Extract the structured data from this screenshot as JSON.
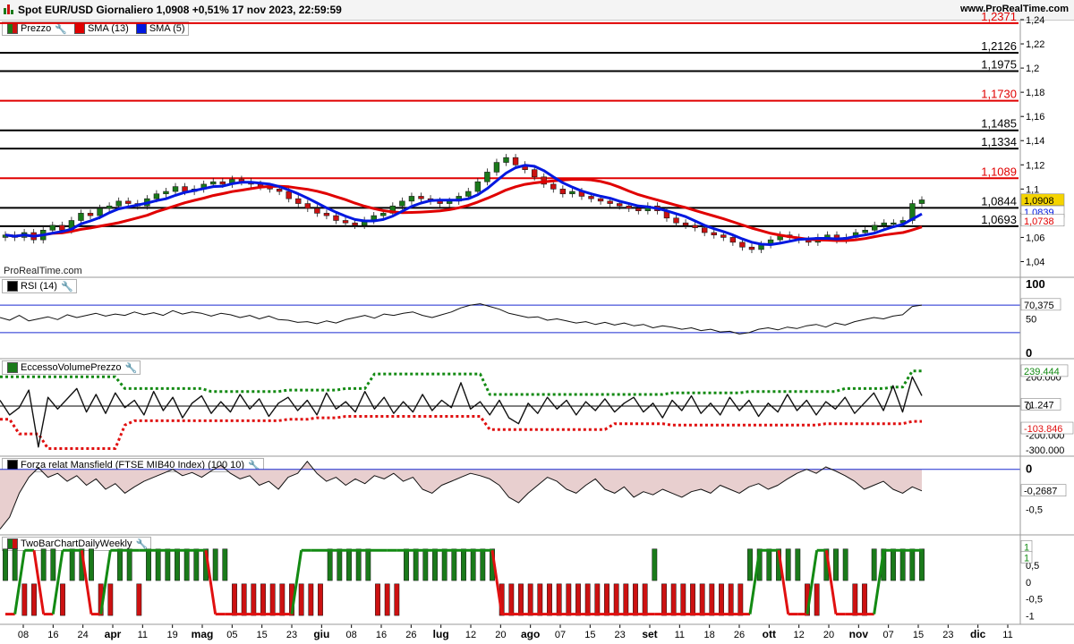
{
  "header": {
    "title": "Spot EUR/USD Giornaliero 1,0908 +0,51% 17 nov 2023, 22:59:59",
    "brand": "www.ProRealTime.com",
    "watermark": "ProRealTime.com"
  },
  "legends": {
    "price": {
      "label": "Prezzo",
      "sma13": "SMA (13)",
      "sma5": "SMA (5)"
    },
    "rsi": "RSI (14)",
    "volume": "EccessoVolumePrezzo",
    "mansfield": "Forza relat Mansfield (FTSE MIB40 Index) (100 10)",
    "twobar": "TwoBarChartDailyWeekly"
  },
  "colors": {
    "up": "#1a7a1a",
    "down": "#cc1111",
    "sma13": "#e00000",
    "sma5": "#0018e0",
    "hline_red": "#e00000",
    "hline_black": "#000000",
    "current": "#f5d400"
  },
  "price_axis": {
    "ticks": [
      "1,24",
      "1,22",
      "1,2",
      "1,18",
      "1,16",
      "1,14",
      "1,12",
      "1,1",
      "1,08",
      "1,06",
      "1,04"
    ]
  },
  "x_axis": {
    "labels": [
      "08",
      "16",
      "24",
      "apr",
      "11",
      "19",
      "mag",
      "05",
      "15",
      "23",
      "giu",
      "08",
      "16",
      "26",
      "lug",
      "12",
      "20",
      "ago",
      "07",
      "15",
      "23",
      "set",
      "11",
      "18",
      "26",
      "ott",
      "12",
      "20",
      "nov",
      "07",
      "15",
      "23",
      "dic",
      "11"
    ]
  },
  "chart_data": [
    {
      "type": "candlestick",
      "title": "Spot EUR/USD Giornaliero",
      "ylim": [
        1.03,
        1.24
      ],
      "horizontal_levels": [
        {
          "value": 1.2371,
          "label": "1,2371",
          "color": "red"
        },
        {
          "value": 1.2126,
          "label": "1,2126",
          "color": "black"
        },
        {
          "value": 1.1975,
          "label": "1,1975",
          "color": "black"
        },
        {
          "value": 1.173,
          "label": "1,1730",
          "color": "red"
        },
        {
          "value": 1.1485,
          "label": "1,1485",
          "color": "black"
        },
        {
          "value": 1.1334,
          "label": "1,1334",
          "color": "black"
        },
        {
          "value": 1.1089,
          "label": "1,1089",
          "color": "red"
        },
        {
          "value": 1.0844,
          "label": "1,0844",
          "color": "black"
        },
        {
          "value": 1.0693,
          "label": "1,0693",
          "color": "black"
        }
      ],
      "last_price": {
        "value": 1.0908,
        "label": "1,0908"
      },
      "sma5_last": {
        "value": 1.0839,
        "label": "1,0839"
      },
      "sma13_last": {
        "value": 1.0738,
        "label": "1,0738"
      },
      "close_path": [
        1.062,
        1.06,
        1.064,
        1.058,
        1.066,
        1.07,
        1.066,
        1.074,
        1.08,
        1.078,
        1.084,
        1.086,
        1.09,
        1.088,
        1.086,
        1.092,
        1.096,
        1.098,
        1.102,
        1.098,
        1.1,
        1.104,
        1.106,
        1.104,
        1.108,
        1.106,
        1.104,
        1.102,
        1.1,
        1.098,
        1.092,
        1.088,
        1.084,
        1.08,
        1.078,
        1.074,
        1.072,
        1.07,
        1.074,
        1.078,
        1.08,
        1.086,
        1.09,
        1.094,
        1.092,
        1.09,
        1.088,
        1.09,
        1.094,
        1.098,
        1.106,
        1.114,
        1.122,
        1.126,
        1.12,
        1.116,
        1.11,
        1.104,
        1.1,
        1.096,
        1.098,
        1.094,
        1.092,
        1.09,
        1.088,
        1.086,
        1.084,
        1.082,
        1.086,
        1.082,
        1.076,
        1.072,
        1.07,
        1.068,
        1.064,
        1.062,
        1.06,
        1.056,
        1.052,
        1.05,
        1.054,
        1.058,
        1.062,
        1.06,
        1.058,
        1.056,
        1.06,
        1.062,
        1.058,
        1.06,
        1.064,
        1.066,
        1.07,
        1.072,
        1.072,
        1.074,
        1.088,
        1.091
      ]
    },
    {
      "type": "line",
      "title": "RSI (14)",
      "ylim": [
        0,
        100
      ],
      "ticks": [
        "100",
        "50",
        "0"
      ],
      "reference_lines": [
        30,
        70
      ],
      "last": {
        "value": 70.375,
        "label": "70,375"
      },
      "values": [
        52,
        48,
        55,
        47,
        50,
        53,
        49,
        56,
        52,
        55,
        58,
        54,
        57,
        55,
        60,
        56,
        59,
        55,
        62,
        57,
        60,
        58,
        54,
        58,
        56,
        52,
        55,
        50,
        54,
        49,
        48,
        45,
        46,
        43,
        47,
        44,
        49,
        52,
        55,
        51,
        57,
        55,
        58,
        60,
        55,
        52,
        56,
        60,
        66,
        70,
        72,
        68,
        64,
        58,
        55,
        52,
        53,
        48,
        50,
        47,
        44,
        46,
        42,
        45,
        41,
        44,
        40,
        42,
        37,
        40,
        38,
        35,
        37,
        33,
        35,
        31,
        32,
        28,
        30,
        35,
        37,
        34,
        38,
        36,
        40,
        42,
        38,
        44,
        41,
        46,
        49,
        52,
        50,
        54,
        56,
        68,
        70
      ]
    },
    {
      "type": "line",
      "title": "EccessoVolumePrezzo",
      "ylim": [
        -330000,
        300000
      ],
      "ticks": [
        "200.000",
        "0",
        "-200.000",
        "-300.000"
      ],
      "markers": [
        {
          "value": 239444,
          "label": "239.444"
        },
        {
          "value": 71247,
          "label": "71.247"
        },
        {
          "value": 0,
          "label": "0"
        },
        {
          "value": -103846,
          "label": "-103.846"
        }
      ],
      "upper_band": [
        200000,
        200000,
        200000,
        200000,
        200000,
        200000,
        200000,
        200000,
        200000,
        200000,
        200000,
        200000,
        200000,
        120000,
        120000,
        120000,
        120000,
        120000,
        120000,
        120000,
        120000,
        120000,
        100000,
        100000,
        100000,
        100000,
        100000,
        100000,
        100000,
        100000,
        110000,
        110000,
        110000,
        110000,
        110000,
        110000,
        120000,
        120000,
        120000,
        220000,
        220000,
        220000,
        220000,
        220000,
        220000,
        220000,
        220000,
        220000,
        220000,
        220000,
        220000,
        80000,
        80000,
        80000,
        80000,
        80000,
        80000,
        80000,
        80000,
        80000,
        80000,
        80000,
        80000,
        80000,
        80000,
        80000,
        80000,
        80000,
        80000,
        80000,
        90000,
        90000,
        90000,
        90000,
        90000,
        90000,
        90000,
        90000,
        100000,
        100000,
        100000,
        100000,
        100000,
        100000,
        100000,
        100000,
        100000,
        100000,
        120000,
        120000,
        120000,
        120000,
        120000,
        130000,
        130000,
        240000,
        240000
      ],
      "lower_band": [
        -90000,
        -90000,
        -190000,
        -190000,
        -190000,
        -290000,
        -290000,
        -290000,
        -290000,
        -290000,
        -290000,
        -290000,
        -290000,
        -130000,
        -100000,
        -100000,
        -100000,
        -100000,
        -100000,
        -100000,
        -100000,
        -100000,
        -100000,
        -100000,
        -100000,
        -100000,
        -100000,
        -100000,
        -100000,
        -100000,
        -90000,
        -90000,
        -90000,
        -80000,
        -80000,
        -80000,
        -70000,
        -70000,
        -70000,
        -70000,
        -70000,
        -70000,
        -70000,
        -70000,
        -70000,
        -70000,
        -70000,
        -70000,
        -70000,
        -70000,
        -70000,
        -160000,
        -160000,
        -160000,
        -160000,
        -160000,
        -160000,
        -160000,
        -160000,
        -160000,
        -160000,
        -160000,
        -160000,
        -160000,
        -120000,
        -120000,
        -120000,
        -120000,
        -120000,
        -120000,
        -130000,
        -130000,
        -130000,
        -130000,
        -130000,
        -130000,
        -130000,
        -130000,
        -130000,
        -130000,
        -130000,
        -130000,
        -130000,
        -130000,
        -130000,
        -130000,
        -120000,
        -120000,
        -120000,
        -120000,
        -120000,
        -120000,
        -120000,
        -120000,
        -120000,
        -104000,
        -104000
      ],
      "values": [
        40000,
        -60000,
        -10000,
        110000,
        -280000,
        60000,
        -20000,
        50000,
        120000,
        -40000,
        80000,
        -50000,
        90000,
        -10000,
        40000,
        -60000,
        100000,
        -30000,
        60000,
        -80000,
        20000,
        70000,
        -50000,
        30000,
        -40000,
        80000,
        -20000,
        50000,
        -70000,
        20000,
        60000,
        -30000,
        40000,
        -60000,
        90000,
        -20000,
        30000,
        -40000,
        100000,
        -20000,
        60000,
        -50000,
        30000,
        -40000,
        80000,
        -30000,
        40000,
        -10000,
        160000,
        -20000,
        30000,
        -60000,
        40000,
        -80000,
        -120000,
        20000,
        -50000,
        60000,
        -20000,
        40000,
        -60000,
        30000,
        -30000,
        50000,
        -40000,
        20000,
        60000,
        -40000,
        20000,
        -80000,
        40000,
        -30000,
        70000,
        -50000,
        20000,
        -60000,
        60000,
        -30000,
        40000,
        -70000,
        20000,
        -40000,
        80000,
        -30000,
        40000,
        -60000,
        30000,
        -20000,
        60000,
        -50000,
        20000,
        90000,
        -30000,
        140000,
        -40000,
        200000,
        71000
      ]
    },
    {
      "type": "area",
      "title": "Forza relat Mansfield (FTSE MIB40 Index) (100 10)",
      "ylim": [
        -0.8,
        0.12
      ],
      "ticks": [
        "0",
        "-0,5"
      ],
      "last": {
        "value": -0.2687,
        "label": "-0,2687"
      },
      "values": [
        -0.75,
        -0.6,
        -0.3,
        -0.1,
        0.02,
        -0.1,
        -0.05,
        -0.15,
        -0.08,
        -0.2,
        -0.12,
        -0.25,
        -0.18,
        -0.3,
        -0.22,
        -0.15,
        -0.1,
        -0.05,
        0,
        -0.08,
        -0.04,
        -0.1,
        -0.02,
        0.05,
        -0.05,
        -0.12,
        -0.08,
        -0.2,
        -0.15,
        -0.25,
        -0.1,
        -0.05,
        0.1,
        -0.05,
        -0.15,
        -0.1,
        -0.2,
        -0.12,
        -0.18,
        -0.08,
        -0.12,
        -0.05,
        -0.15,
        -0.1,
        -0.25,
        -0.3,
        -0.2,
        -0.15,
        -0.1,
        -0.05,
        -0.08,
        -0.12,
        -0.2,
        -0.35,
        -0.42,
        -0.3,
        -0.2,
        -0.1,
        -0.15,
        -0.25,
        -0.3,
        -0.2,
        -0.12,
        -0.25,
        -0.3,
        -0.22,
        -0.35,
        -0.28,
        -0.32,
        -0.25,
        -0.3,
        -0.35,
        -0.28,
        -0.25,
        -0.3,
        -0.2,
        -0.25,
        -0.3,
        -0.22,
        -0.18,
        -0.25,
        -0.2,
        -0.12,
        -0.05,
        0,
        -0.05,
        0.03,
        -0.02,
        -0.08,
        -0.15,
        -0.25,
        -0.2,
        -0.15,
        -0.25,
        -0.3,
        -0.22,
        -0.27
      ]
    },
    {
      "type": "bar",
      "title": "TwoBarChartDailyWeekly",
      "ylim": [
        -1.2,
        1.25
      ],
      "ticks": [
        "1",
        "0,5",
        "0",
        "-0,5",
        "-1"
      ],
      "last": {
        "value": 1,
        "label": "1"
      },
      "daily": [
        1,
        1,
        -1,
        -1,
        1,
        1,
        -1,
        1,
        1,
        1,
        -1,
        -1,
        1,
        1,
        -1,
        1,
        1,
        1,
        1,
        1,
        1,
        1,
        1,
        1,
        -1,
        -1,
        -1,
        -1,
        -1,
        -1,
        -1,
        -1,
        -1,
        -1,
        1,
        1,
        1,
        1,
        1,
        -1,
        -1,
        -1,
        1,
        1,
        1,
        1,
        1,
        1,
        1,
        1,
        1,
        1,
        -1,
        -1,
        -1,
        -1,
        -1,
        -1,
        -1,
        -1,
        -1,
        -1,
        -1,
        -1,
        -1,
        -1,
        -1,
        -1,
        1,
        -1,
        -1,
        -1,
        -1,
        -1,
        -1,
        -1,
        -1,
        -1,
        1,
        1,
        1,
        1,
        1,
        1,
        -1,
        -1,
        1,
        1,
        1,
        -1,
        -1,
        1,
        1,
        1,
        1,
        1,
        1
      ],
      "weekly": [
        -1,
        -1,
        1,
        1,
        -1,
        -1,
        1,
        1,
        1,
        -1,
        -1,
        1,
        1,
        1,
        1,
        1,
        1,
        1,
        1,
        1,
        1,
        1,
        -1,
        -1,
        -1,
        -1,
        -1,
        -1,
        -1,
        -1,
        -1,
        1,
        1,
        1,
        1,
        1,
        1,
        1,
        1,
        1,
        1,
        1,
        1,
        1,
        1,
        1,
        1,
        1,
        1,
        1,
        1,
        1,
        -1,
        -1,
        -1,
        -1,
        -1,
        -1,
        -1,
        -1,
        -1,
        -1,
        -1,
        -1,
        -1,
        -1,
        -1,
        -1,
        -1,
        -1,
        -1,
        -1,
        -1,
        -1,
        -1,
        -1,
        -1,
        -1,
        -1,
        1,
        1,
        1,
        -1,
        -1,
        -1,
        1,
        1,
        -1,
        -1,
        -1,
        -1,
        -1,
        1,
        1,
        1,
        1,
        1,
        1
      ]
    }
  ]
}
